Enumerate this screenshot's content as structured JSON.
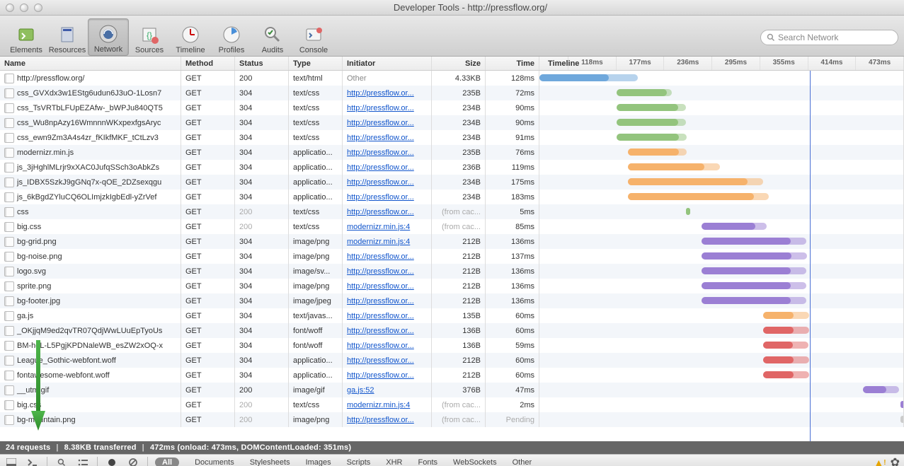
{
  "window": {
    "title": "Developer Tools - http://pressflow.org/"
  },
  "toolbar": {
    "tabs": [
      "Elements",
      "Resources",
      "Network",
      "Sources",
      "Timeline",
      "Profiles",
      "Audits",
      "Console"
    ],
    "selected": 2,
    "search_placeholder": "Search Network"
  },
  "columns": {
    "name": "Name",
    "method": "Method",
    "status": "Status",
    "type": "Type",
    "initiator": "Initiator",
    "size": "Size",
    "time": "Time",
    "timeline": "Timeline"
  },
  "ticks": [
    "118ms",
    "177ms",
    "236ms",
    "295ms",
    "355ms",
    "414ms",
    "473ms"
  ],
  "timeline": {
    "max_ms": 473,
    "domcontentloaded_ms": 351,
    "onload_ms": 473,
    "colors": {
      "document": "#6fa8dc",
      "stylesheet": "#93c47d",
      "script": "#f6b26b",
      "pending": "#cfe2b0",
      "image": "#9b7fd4",
      "font": "#e06666",
      "xhr": "#cccccc"
    }
  },
  "init_labels": {
    "other": "Other",
    "press": "http://pressflow.or...",
    "mod": "modernizr.min.js:4",
    "ga": "ga.js:52"
  },
  "requests": [
    {
      "name": "http://pressflow.org/",
      "method": "GET",
      "status": "200",
      "type": "text/html",
      "init": "other",
      "init_dim": true,
      "size": "4.33KB",
      "time": "128ms",
      "bar_s": 0,
      "bar_e": 90,
      "bar_l": 128,
      "color": "document"
    },
    {
      "name": "css_GVXdx3w1EStg6udun6J3uO-1Losn7",
      "method": "GET",
      "status": "304",
      "type": "text/css",
      "init": "press",
      "size": "235B",
      "time": "72ms",
      "bar_s": 100,
      "bar_e": 165,
      "bar_l": 172,
      "color": "stylesheet"
    },
    {
      "name": "css_TsVRTbLFUpEZAfw-_bWPJu840QT5",
      "method": "GET",
      "status": "304",
      "type": "text/css",
      "init": "press",
      "size": "234B",
      "time": "90ms",
      "bar_s": 100,
      "bar_e": 180,
      "bar_l": 190,
      "color": "stylesheet"
    },
    {
      "name": "css_Wu8npAzy16WmnnnWKxpexfgsAryc",
      "method": "GET",
      "status": "304",
      "type": "text/css",
      "init": "press",
      "size": "234B",
      "time": "90ms",
      "bar_s": 100,
      "bar_e": 180,
      "bar_l": 190,
      "color": "stylesheet"
    },
    {
      "name": "css_ewn9Zm3A4s4zr_fKIkfMKF_tCtLzv3",
      "method": "GET",
      "status": "304",
      "type": "text/css",
      "init": "press",
      "size": "234B",
      "time": "91ms",
      "bar_s": 100,
      "bar_e": 181,
      "bar_l": 191,
      "color": "stylesheet"
    },
    {
      "name": "modernizr.min.js",
      "method": "GET",
      "status": "304",
      "type": "applicatio...",
      "init": "press",
      "size": "235B",
      "time": "76ms",
      "bar_s": 115,
      "bar_e": 181,
      "bar_l": 191,
      "color": "script"
    },
    {
      "name": "js_3jHghlMLrjr9xXAC0JufqSSch3oAbkZs",
      "method": "GET",
      "status": "304",
      "type": "applicatio...",
      "init": "press",
      "size": "236B",
      "time": "119ms",
      "bar_s": 115,
      "bar_e": 214,
      "bar_l": 234,
      "color": "script"
    },
    {
      "name": "js_IDBX5SzkJ9gGNq7x-qOE_2DZsexqgu",
      "method": "GET",
      "status": "304",
      "type": "applicatio...",
      "init": "press",
      "size": "234B",
      "time": "175ms",
      "bar_s": 115,
      "bar_e": 270,
      "bar_l": 290,
      "color": "script"
    },
    {
      "name": "js_6kBgdZYluCQ6OLImjzkIgbEdl-yZrVef",
      "method": "GET",
      "status": "304",
      "type": "applicatio...",
      "init": "press",
      "size": "234B",
      "time": "183ms",
      "bar_s": 115,
      "bar_e": 278,
      "bar_l": 298,
      "color": "script"
    },
    {
      "name": "css",
      "method": "GET",
      "status": "200",
      "status_dim": true,
      "type": "text/css",
      "init": "press",
      "size": "(from cac...",
      "size_dim": true,
      "time": "5ms",
      "bar_s": 190,
      "bar_e": 195,
      "bar_l": 195,
      "color": "stylesheet"
    },
    {
      "name": "big.css",
      "method": "GET",
      "status": "200",
      "status_dim": true,
      "type": "text/css",
      "init": "mod",
      "size": "(from cac...",
      "size_dim": true,
      "time": "85ms",
      "bar_s": 210,
      "bar_e": 280,
      "bar_l": 295,
      "color": "image"
    },
    {
      "name": "bg-grid.png",
      "method": "GET",
      "status": "304",
      "type": "image/png",
      "init": "mod",
      "size": "212B",
      "time": "136ms",
      "bar_s": 210,
      "bar_e": 326,
      "bar_l": 346,
      "color": "image"
    },
    {
      "name": "bg-noise.png",
      "method": "GET",
      "status": "304",
      "type": "image/png",
      "init": "press",
      "size": "212B",
      "time": "137ms",
      "bar_s": 210,
      "bar_e": 327,
      "bar_l": 347,
      "color": "image"
    },
    {
      "name": "logo.svg",
      "method": "GET",
      "status": "304",
      "type": "image/sv...",
      "init": "press",
      "size": "212B",
      "time": "136ms",
      "bar_s": 210,
      "bar_e": 326,
      "bar_l": 346,
      "color": "image"
    },
    {
      "name": "sprite.png",
      "method": "GET",
      "status": "304",
      "type": "image/png",
      "init": "press",
      "size": "212B",
      "time": "136ms",
      "bar_s": 210,
      "bar_e": 326,
      "bar_l": 346,
      "color": "image"
    },
    {
      "name": "bg-footer.jpg",
      "method": "GET",
      "status": "304",
      "type": "image/jpeg",
      "init": "press",
      "size": "212B",
      "time": "136ms",
      "bar_s": 210,
      "bar_e": 326,
      "bar_l": 346,
      "color": "image"
    },
    {
      "name": "ga.js",
      "method": "GET",
      "status": "304",
      "type": "text/javas...",
      "init": "press",
      "size": "135B",
      "time": "60ms",
      "bar_s": 290,
      "bar_e": 330,
      "bar_l": 350,
      "color": "script"
    },
    {
      "name": "_OKjjqM9ed2qvTR07QdjWwLUuEpTyoUs",
      "method": "GET",
      "status": "304",
      "type": "font/woff",
      "init": "press",
      "size": "136B",
      "time": "60ms",
      "bar_s": 290,
      "bar_e": 330,
      "bar_l": 350,
      "color": "font"
    },
    {
      "name": "BM-hqL-L5PgjKPDNaleWB_esZW2xOQ-x",
      "method": "GET",
      "status": "304",
      "type": "font/woff",
      "init": "press",
      "size": "136B",
      "time": "59ms",
      "bar_s": 290,
      "bar_e": 329,
      "bar_l": 349,
      "color": "font"
    },
    {
      "name": "League_Gothic-webfont.woff",
      "method": "GET",
      "status": "304",
      "type": "applicatio...",
      "init": "press",
      "size": "212B",
      "time": "60ms",
      "bar_s": 290,
      "bar_e": 330,
      "bar_l": 350,
      "color": "font"
    },
    {
      "name": "fontawesome-webfont.woff",
      "method": "GET",
      "status": "304",
      "type": "applicatio...",
      "init": "press",
      "size": "212B",
      "time": "60ms",
      "bar_s": 290,
      "bar_e": 330,
      "bar_l": 350,
      "color": "font"
    },
    {
      "name": "__utm.gif",
      "method": "GET",
      "status": "200",
      "type": "image/gif",
      "init": "ga",
      "size": "376B",
      "time": "47ms",
      "bar_s": 420,
      "bar_e": 450,
      "bar_l": 467,
      "color": "image"
    },
    {
      "name": "big.css",
      "method": "GET",
      "status": "200",
      "status_dim": true,
      "type": "text/css",
      "init": "mod",
      "size": "(from cac...",
      "size_dim": true,
      "time": "2ms",
      "bar_s": 468,
      "bar_e": 470,
      "bar_l": 470,
      "color": "image"
    },
    {
      "name": "bg-mountain.png",
      "method": "GET",
      "status": "200",
      "status_dim": true,
      "type": "image/png",
      "init": "press",
      "size": "(from cac...",
      "size_dim": true,
      "time": "Pending",
      "time_dim": true,
      "bar_s": 468,
      "bar_e": 473,
      "bar_l": 473,
      "color": "xhr"
    }
  ],
  "status": {
    "requests": "24 requests",
    "transferred": "8.38KB transferred",
    "timing": "472ms (onload: 473ms, DOMContentLoaded: 351ms)"
  },
  "filters": {
    "all": "All",
    "items": [
      "Documents",
      "Stylesheets",
      "Images",
      "Scripts",
      "XHR",
      "Fonts",
      "WebSockets",
      "Other"
    ]
  }
}
